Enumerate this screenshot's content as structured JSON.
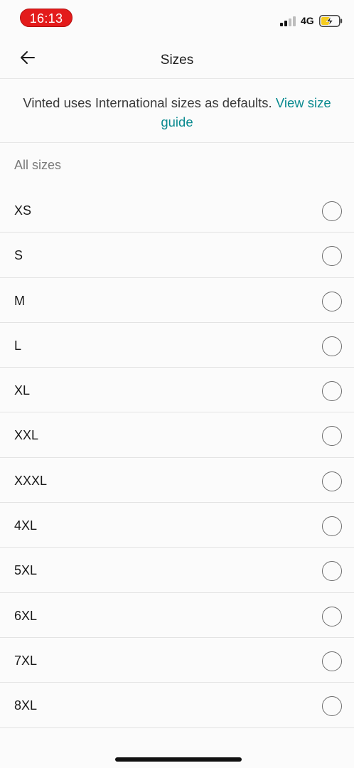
{
  "status_bar": {
    "time": "16:13",
    "network": "4G",
    "icons": [
      "cellular-signal-icon",
      "battery-charging-icon"
    ],
    "colors": {
      "time_pill": "#e31b1b",
      "battery_fill": "#f5cc1f"
    }
  },
  "header": {
    "back_icon": "arrow-left-icon",
    "title": "Sizes"
  },
  "info": {
    "text": "Vinted uses International sizes as defaults.",
    "link_text": "View size guide",
    "link_color": "#0a8a8f"
  },
  "section": {
    "title": "All sizes"
  },
  "sizes": [
    {
      "label": "XS",
      "selected": false
    },
    {
      "label": "S",
      "selected": false
    },
    {
      "label": "M",
      "selected": false
    },
    {
      "label": "L",
      "selected": false
    },
    {
      "label": "XL",
      "selected": false
    },
    {
      "label": "XXL",
      "selected": false
    },
    {
      "label": "XXXL",
      "selected": false
    },
    {
      "label": "4XL",
      "selected": false
    },
    {
      "label": "5XL",
      "selected": false
    },
    {
      "label": "6XL",
      "selected": false
    },
    {
      "label": "7XL",
      "selected": false
    },
    {
      "label": "8XL",
      "selected": false
    }
  ]
}
